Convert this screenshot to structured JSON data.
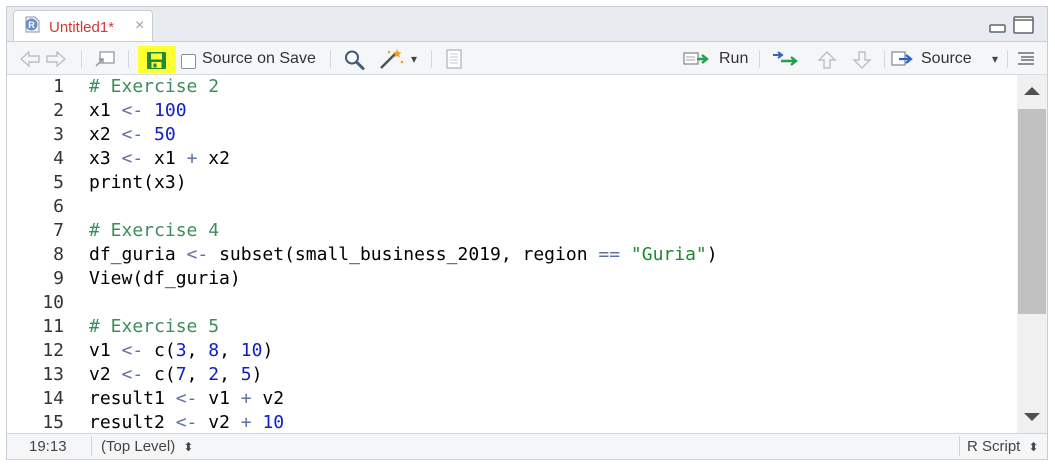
{
  "tab": {
    "title": "Untitled1*",
    "close": "×",
    "r_badge": "R"
  },
  "toolbar": {
    "source_on_save": "Source on Save",
    "run": "Run",
    "source": "Source",
    "dropdown": "▾"
  },
  "editor": {
    "lines": [
      {
        "n": "1",
        "parts": [
          {
            "t": "# Exercise 2",
            "c": "c-com"
          }
        ]
      },
      {
        "n": "2",
        "parts": [
          {
            "t": "x1 ",
            "c": ""
          },
          {
            "t": "<-",
            "c": "c-op"
          },
          {
            "t": " ",
            "c": ""
          },
          {
            "t": "100",
            "c": "c-num"
          }
        ]
      },
      {
        "n": "3",
        "parts": [
          {
            "t": "x2 ",
            "c": ""
          },
          {
            "t": "<-",
            "c": "c-op"
          },
          {
            "t": " ",
            "c": ""
          },
          {
            "t": "50",
            "c": "c-num"
          }
        ]
      },
      {
        "n": "4",
        "parts": [
          {
            "t": "x3 ",
            "c": ""
          },
          {
            "t": "<-",
            "c": "c-op"
          },
          {
            "t": " x1 ",
            "c": ""
          },
          {
            "t": "+",
            "c": "c-op"
          },
          {
            "t": " x2",
            "c": ""
          }
        ]
      },
      {
        "n": "5",
        "parts": [
          {
            "t": "print(x3)",
            "c": ""
          }
        ]
      },
      {
        "n": "6",
        "parts": []
      },
      {
        "n": "7",
        "parts": [
          {
            "t": "# Exercise 4",
            "c": "c-com"
          }
        ]
      },
      {
        "n": "8",
        "parts": [
          {
            "t": "df_guria ",
            "c": ""
          },
          {
            "t": "<-",
            "c": "c-op"
          },
          {
            "t": " subset(small_business_2019, region ",
            "c": ""
          },
          {
            "t": "==",
            "c": "c-op"
          },
          {
            "t": " ",
            "c": ""
          },
          {
            "t": "\"Guria\"",
            "c": "c-str"
          },
          {
            "t": ")",
            "c": ""
          }
        ]
      },
      {
        "n": "9",
        "parts": [
          {
            "t": "View(df_guria)",
            "c": ""
          }
        ]
      },
      {
        "n": "10",
        "parts": []
      },
      {
        "n": "11",
        "parts": [
          {
            "t": "# Exercise 5",
            "c": "c-com"
          }
        ]
      },
      {
        "n": "12",
        "parts": [
          {
            "t": "v1 ",
            "c": ""
          },
          {
            "t": "<-",
            "c": "c-op"
          },
          {
            "t": " c(",
            "c": ""
          },
          {
            "t": "3",
            "c": "c-num"
          },
          {
            "t": ", ",
            "c": ""
          },
          {
            "t": "8",
            "c": "c-num"
          },
          {
            "t": ", ",
            "c": ""
          },
          {
            "t": "10",
            "c": "c-num"
          },
          {
            "t": ")",
            "c": ""
          }
        ]
      },
      {
        "n": "13",
        "parts": [
          {
            "t": "v2 ",
            "c": ""
          },
          {
            "t": "<-",
            "c": "c-op"
          },
          {
            "t": " c(",
            "c": ""
          },
          {
            "t": "7",
            "c": "c-num"
          },
          {
            "t": ", ",
            "c": ""
          },
          {
            "t": "2",
            "c": "c-num"
          },
          {
            "t": ", ",
            "c": ""
          },
          {
            "t": "5",
            "c": "c-num"
          },
          {
            "t": ")",
            "c": ""
          }
        ]
      },
      {
        "n": "14",
        "parts": [
          {
            "t": "result1 ",
            "c": ""
          },
          {
            "t": "<-",
            "c": "c-op"
          },
          {
            "t": " v1 ",
            "c": ""
          },
          {
            "t": "+",
            "c": "c-op"
          },
          {
            "t": " v2",
            "c": ""
          }
        ]
      },
      {
        "n": "15",
        "parts": [
          {
            "t": "result2 ",
            "c": ""
          },
          {
            "t": "<-",
            "c": "c-op"
          },
          {
            "t": " v2 ",
            "c": ""
          },
          {
            "t": "+",
            "c": "c-op"
          },
          {
            "t": " ",
            "c": ""
          },
          {
            "t": "10",
            "c": "c-num"
          }
        ]
      }
    ]
  },
  "status": {
    "cursor": "19:13",
    "scope": "(Top Level)",
    "scope_arrows": "⬍",
    "filetype": "R Script",
    "filetype_arrows": "⬍"
  },
  "colors": {
    "save_highlight": "#ffff33",
    "tab_title": "#d03a3a",
    "comment": "#3c8d5b",
    "number": "#1020c8",
    "string": "#1d8a2e"
  },
  "icons": [
    "r-file-icon",
    "back-arrow-icon",
    "forward-arrow-icon",
    "show-in-window-icon",
    "save-icon",
    "search-icon",
    "magic-wand-icon",
    "compile-notebook-icon",
    "run-icon",
    "rerun-icon",
    "up-arrow-icon",
    "down-arrow-icon",
    "source-icon",
    "outline-icon",
    "minimize-icon",
    "maximize-icon"
  ]
}
